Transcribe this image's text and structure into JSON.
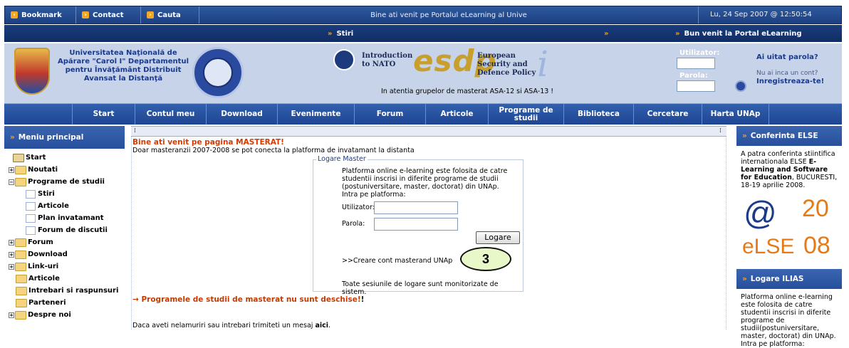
{
  "topbar": {
    "bookmark": "Bookmark",
    "contact": "Contact",
    "cauta": "Cauta",
    "welcome": "Bine ati venit pe Portalul eLearning al Unive",
    "datetime": "Lu, 24 Sep 2007 @ 12:50:54"
  },
  "subbar": {
    "news": "Stiri",
    "welcome_portal": "Bun venit la Portal eLearning"
  },
  "header": {
    "university": "Universitatea Naţională de Apărare \"Carol I\" Departamentul pentru Învăţământ Distribuit Avansat la Distanţă",
    "nato_text": "Introduction to NATO",
    "esdp": "esdp",
    "eu_text": "European Security and Defence Policy",
    "attention": "In atentia grupelor de masterat ASA-12 si ASA-13 !",
    "login": {
      "user_label": "Utilizator:",
      "pass_label": "Parola:",
      "forgot": "Ai uitat parola?",
      "no_account": "Nu ai inca un cont?",
      "register": "Inregistreaza-te!"
    }
  },
  "nav": {
    "items": [
      "Start",
      "Contul meu",
      "Download",
      "Evenimente",
      "Forum",
      "Articole",
      "Programe de studii",
      "Biblioteca",
      "Cercetare",
      "Harta UNAp"
    ]
  },
  "left_menu": {
    "title": "Meniu principal",
    "items": [
      "Start",
      "Noutati",
      "Programe de studii",
      "Stiri",
      "Articole",
      "Plan invatamant",
      "Forum de discutii",
      "Forum",
      "Download",
      "Link-uri",
      "Articole",
      "Intrebari si raspunsuri",
      "Parteneri",
      "Despre noi"
    ]
  },
  "center": {
    "title": "Bine ati venit pe pagina MASTERAT!",
    "subtitle": "Doar masteranzii 2007-2008 se pot conecta la platforma de invatamant la distanta",
    "fieldset_legend": "Logare Master",
    "intro": "Platforma online e-learning este folosita de catre studentii inscrisi in diferite programe de studii (postuniversitare, master, doctorat) din UNAp. Intra pe platforma:",
    "user_label": "Utilizator:",
    "pass_label": "Parola:",
    "login_button": "Logare",
    "create_account": ">>Creare cont masterand UNAp",
    "monitor": "Toate sesiunile de logare sunt monitorizate de sistem.",
    "badge": "3",
    "warning": "Programele de studii de masterat nu sunt deschise!",
    "warning_tail": "!",
    "help_prefix": "Daca aveti nelamuriri sau intrebari trimiteti un mesaj",
    "help_link": "aici",
    "help_suffix": "."
  },
  "right": {
    "else_title": "Conferinta ELSE",
    "else_text_1": "A patra conferinta stiintifica internationala ELSE",
    "else_text_bold": "E-Learning and Software for Education",
    "else_text_2": ", BUCURESTI, 18-19 aprilie 2008.",
    "logo_20": "20",
    "logo_else": "eLSE",
    "logo_08": "08",
    "ilias_title": "Logare ILIAS",
    "ilias_text": "Platforma online e-learning este folosita de catre studentii inscrisi in diferite programe de studii(postuniversitare, master, doctorat) din UNAp. Intra pe platforma:"
  }
}
